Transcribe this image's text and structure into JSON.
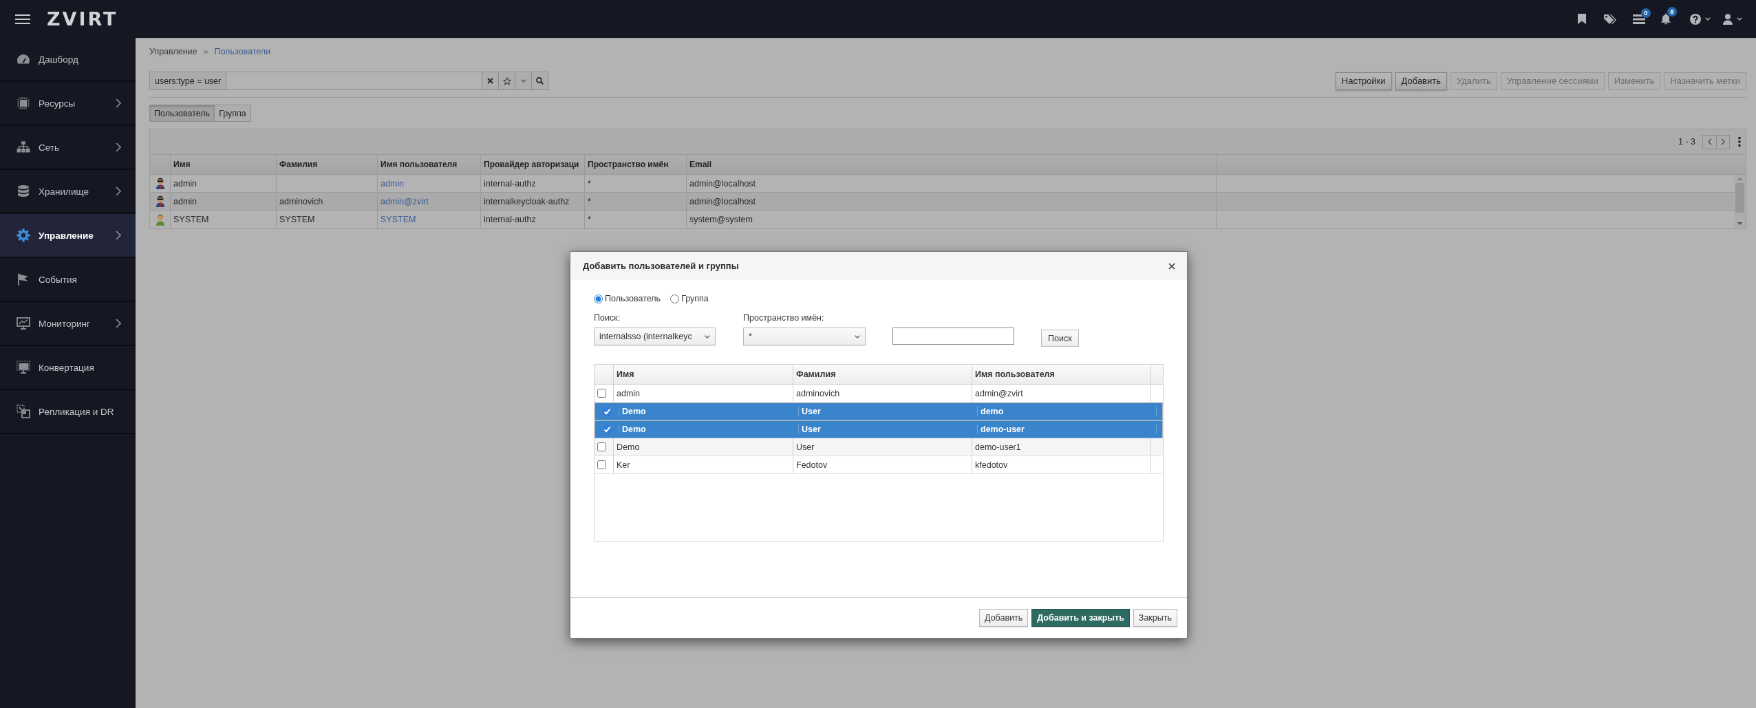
{
  "header": {
    "logo": "ZVIRT",
    "tasks_badge": "0",
    "notifications_badge": "8"
  },
  "sidebar": {
    "items": [
      {
        "label": "Дашборд",
        "expandable": false,
        "selected": false
      },
      {
        "label": "Ресурсы",
        "expandable": true,
        "selected": false
      },
      {
        "label": "Сеть",
        "expandable": true,
        "selected": false
      },
      {
        "label": "Хранилище",
        "expandable": true,
        "selected": false
      },
      {
        "label": "Управление",
        "expandable": true,
        "selected": true
      },
      {
        "label": "События",
        "expandable": false,
        "selected": false
      },
      {
        "label": "Мониторинг",
        "expandable": true,
        "selected": false
      },
      {
        "label": "Конвертация",
        "expandable": false,
        "selected": false
      },
      {
        "label": "Репликация и DR",
        "expandable": false,
        "selected": false
      }
    ]
  },
  "breadcrumb": {
    "items": [
      "Управление",
      "Пользователи"
    ],
    "separator": "»"
  },
  "search": {
    "prefix": "users:type = user"
  },
  "toolbar_buttons": [
    {
      "label": "Настройки",
      "disabled": false
    },
    {
      "label": "Добавить",
      "disabled": false
    },
    {
      "label": "Удалить",
      "disabled": true
    },
    {
      "label": "Управление сессиями",
      "disabled": true
    },
    {
      "label": "Изменить",
      "disabled": true
    },
    {
      "label": "Назначить метки",
      "disabled": true
    }
  ],
  "view_tabs": [
    {
      "label": "Пользователь",
      "selected": true
    },
    {
      "label": "Группа",
      "selected": false
    }
  ],
  "users_table": {
    "pagination": "1 - 3",
    "columns": [
      "Имя",
      "Фамилия",
      "Имя пользователя",
      "Провайдер авторизаци",
      "Пространство имён",
      "Email"
    ],
    "rows": [
      {
        "kind": "admin",
        "first_name": "admin",
        "username": "admin",
        "auth_provider": "internal-authz",
        "namespace": "*",
        "email": "admin@localhost"
      },
      {
        "kind": "admin",
        "first_name": "admin",
        "last_name": "adminovich",
        "username": "admin@zvirt",
        "auth_provider": "internalkeycloak-authz",
        "namespace": "*",
        "email": "admin@localhost"
      },
      {
        "kind": "user",
        "first_name": "SYSTEM",
        "last_name": "SYSTEM",
        "username": "SYSTEM",
        "auth_provider": "internal-authz",
        "namespace": "*",
        "email": "system@system"
      }
    ]
  },
  "dialog": {
    "title": "Добавить пользователей и группы",
    "user_types": [
      {
        "label": "Пользователь",
        "selected": true
      },
      {
        "label": "Группа",
        "selected": false
      }
    ],
    "search_label": "Поиск:",
    "provider": "internalsso (internalkeyc",
    "namespace_label": "Пространство имён:",
    "namespace": "*",
    "search_button": "Поиск",
    "columns": [
      "Имя",
      "Фамилия",
      "Имя пользователя"
    ],
    "rows": [
      {
        "checked": false,
        "selected": false,
        "first_name": "admin",
        "last_name": "adminovich",
        "username": "admin@zvirt"
      },
      {
        "checked": true,
        "selected": true,
        "first_name": "Demo",
        "last_name": "User",
        "username": "demo"
      },
      {
        "checked": true,
        "selected": true,
        "first_name": "Demo",
        "last_name": "User",
        "username": "demo-user"
      },
      {
        "checked": false,
        "selected": false,
        "first_name": "Demo",
        "last_name": "User",
        "username": "demo-user1"
      },
      {
        "checked": false,
        "selected": false,
        "first_name": "Ker",
        "last_name": "Fedotov",
        "username": "kfedotov"
      }
    ],
    "buttons": [
      {
        "label": "Добавить",
        "kind": "default"
      },
      {
        "label": "Добавить и закрыть",
        "kind": "primary"
      },
      {
        "label": "Закрыть",
        "kind": "default"
      }
    ]
  }
}
